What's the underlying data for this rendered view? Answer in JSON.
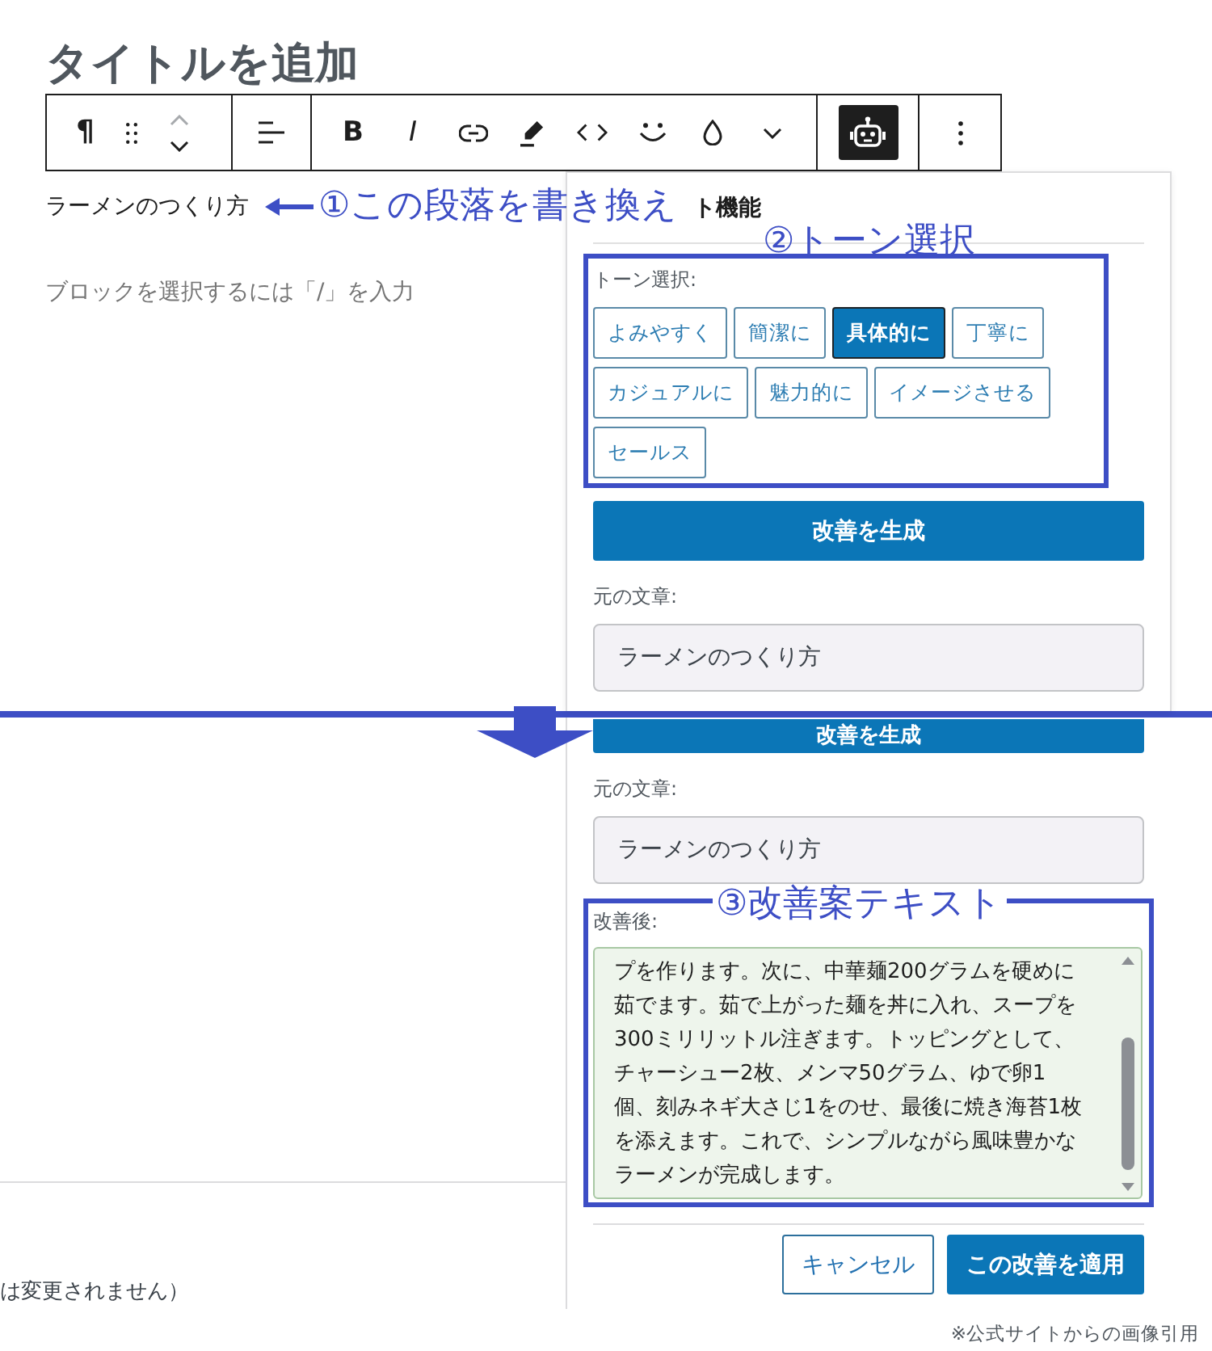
{
  "editor": {
    "title": {
      "placeholder": "タイトルを追加"
    },
    "paragraph": "ラーメンのつくり方",
    "empty_block": {
      "placeholder": "ブロックを選択するには「/」を入力"
    }
  },
  "toolbar": {
    "paragraph_label": "¶",
    "mover_buttons": [
      {
        "disabled": true
      },
      {
        "disabled": false
      }
    ],
    "bold_label": "B",
    "italic_label": "I",
    "ai_button": {
      "pressed": true
    }
  },
  "annotations": {
    "paragraph": "①この段落を書き換え",
    "tone": "②トーン選択",
    "result": "③改善案テキスト"
  },
  "panel_before": {
    "title": "ト機能",
    "tone_label": "トーン選択:",
    "tones": [
      {
        "label": "よみやすく",
        "selected": false
      },
      {
        "label": "簡潔に",
        "selected": false
      },
      {
        "label": "具体的に",
        "selected": true
      },
      {
        "label": "丁寧に",
        "selected": false
      },
      {
        "label": "カジュアルに",
        "selected": false
      },
      {
        "label": "魅力的に",
        "selected": false
      },
      {
        "label": "イメージさせる",
        "selected": false
      },
      {
        "label": "セールス",
        "selected": false
      }
    ],
    "generate_button": "改善を生成",
    "original": {
      "label": "元の文章:",
      "value": "ラーメンのつくり方"
    }
  },
  "editor_after": {
    "note": "は変更されません）"
  },
  "panel_after": {
    "generate_button": "改善を生成",
    "original": {
      "label": "元の文章:",
      "value": "ラーメンのつくり方"
    },
    "improved": {
      "label": "改善後:",
      "value": "プを作ります。次に、中華麺200グラムを硬めに茹でます。茹で上がった麺を丼に入れ、スープを300ミリリットル注ぎます。トッピングとして、チャーシュー2枚、メンマ50グラム、ゆで卵1個、刻みネギ大さじ1をのせ、最後に焼き海苔1枚を添えます。これで、シンプルながら風味豊かなラーメンが完成します。"
    },
    "buttons": {
      "cancel": "キャンセル",
      "apply": "この改善を適用"
    }
  },
  "footnote": "※公式サイトからの画像引用"
}
